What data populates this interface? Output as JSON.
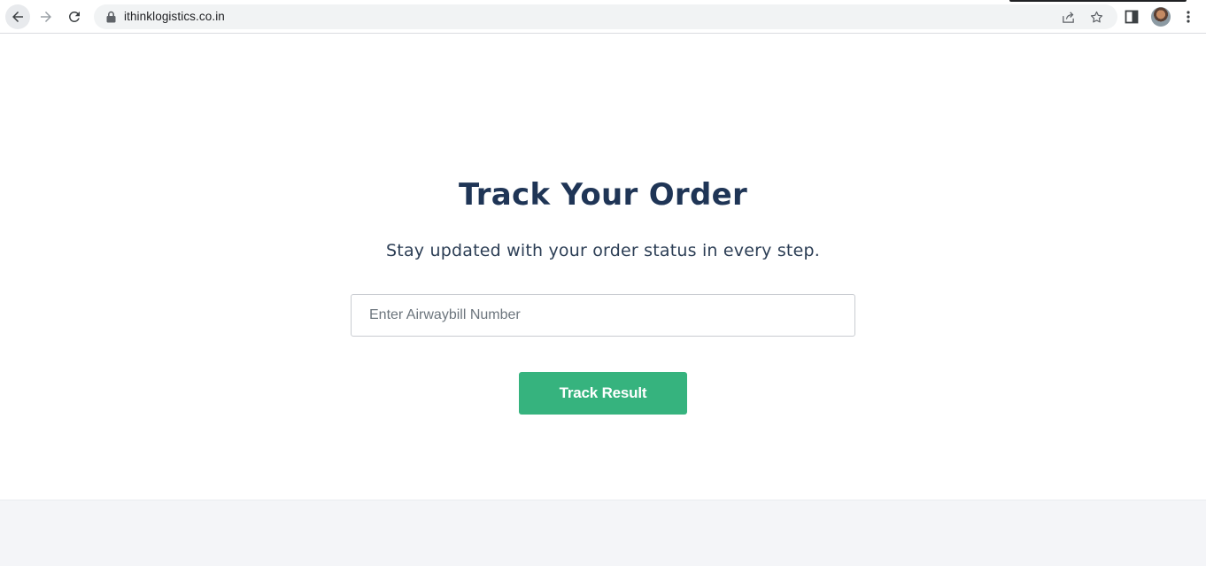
{
  "browser": {
    "url": "ithinklogistics.co.in",
    "icons": {
      "back": "arrow-left-icon",
      "forward": "arrow-right-icon",
      "reload": "reload-icon",
      "lock": "lock-icon",
      "share": "share-icon",
      "bookmark": "star-icon",
      "side_panel": "side-panel-icon",
      "profile": "avatar",
      "menu": "kebab-menu-icon"
    }
  },
  "tracking": {
    "title": "Track Your Order",
    "subtitle": "Stay updated with your order status in every step.",
    "input_placeholder": "Enter Airwaybill Number",
    "input_value": "",
    "button_label": "Track Result"
  },
  "colors": {
    "title": "#1f3556",
    "button": "#36b37e",
    "footer_bg": "#f4f5f8"
  }
}
